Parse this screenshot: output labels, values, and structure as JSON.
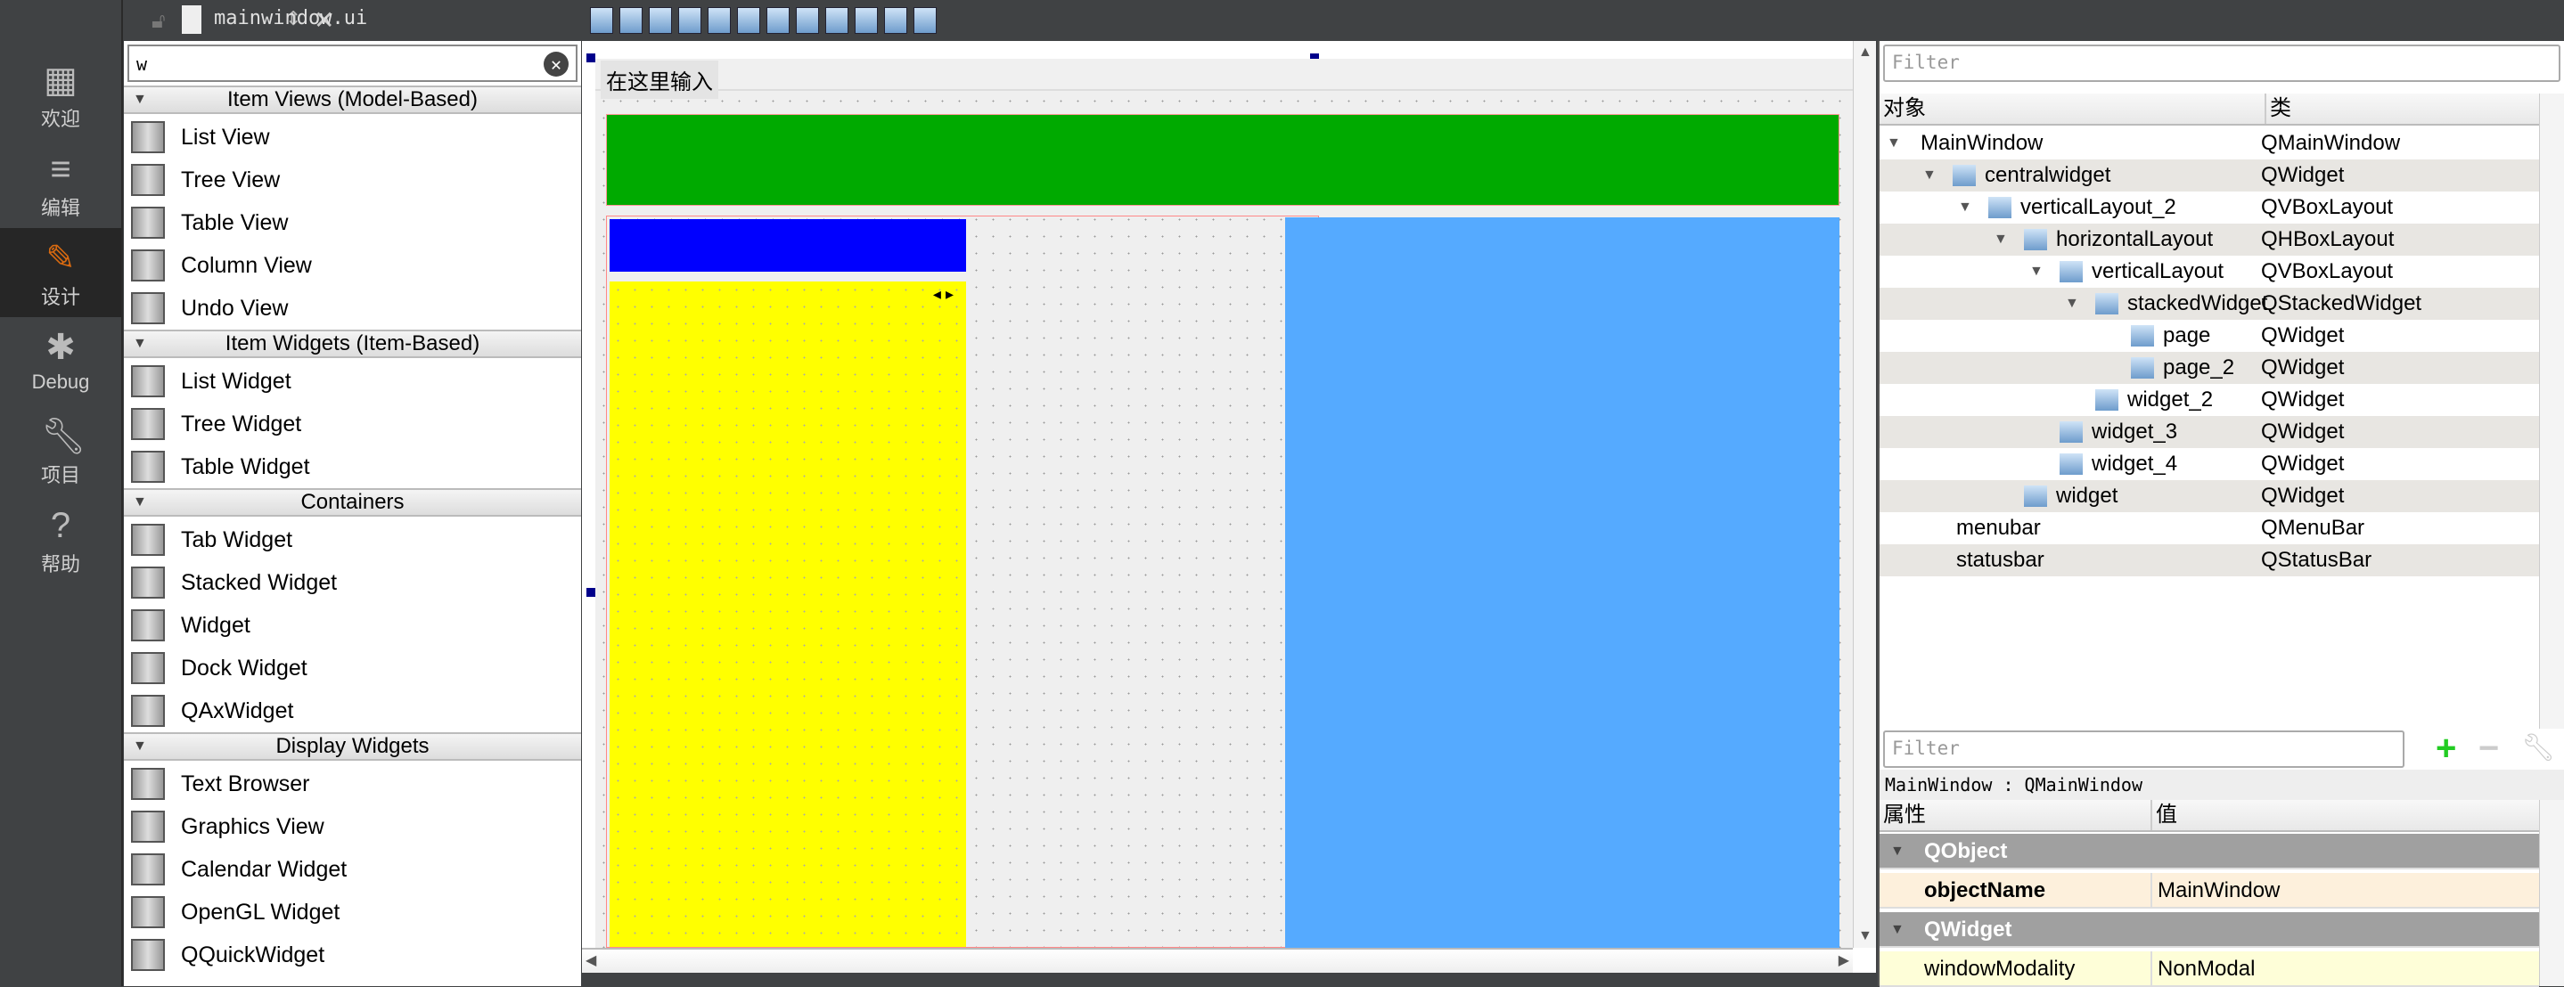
{
  "modebar": [
    {
      "label": "欢迎",
      "icon": "grid-icon"
    },
    {
      "label": "编辑",
      "icon": "document-icon"
    },
    {
      "label": "设计",
      "icon": "pencil-icon",
      "active": true
    },
    {
      "label": "Debug",
      "icon": "bug-icon"
    },
    {
      "label": "项目",
      "icon": "wrench-icon"
    },
    {
      "label": "帮助",
      "icon": "help-icon"
    }
  ],
  "topbar": {
    "file": "mainwindow.ui"
  },
  "widgetbox": {
    "search": "w",
    "categories": [
      {
        "title": "Item Views (Model-Based)",
        "items": [
          "List View",
          "Tree View",
          "Table View",
          "Column View",
          "Undo View"
        ]
      },
      {
        "title": "Item Widgets (Item-Based)",
        "items": [
          "List Widget",
          "Tree Widget",
          "Table Widget"
        ]
      },
      {
        "title": "Containers",
        "items": [
          "Tab Widget",
          "Stacked Widget",
          "Widget",
          "Dock Widget",
          "QAxWidget"
        ]
      },
      {
        "title": "Display Widgets",
        "items": [
          "Text Browser",
          "Graphics View",
          "Calendar Widget",
          "OpenGL Widget",
          "QQuickWidget"
        ]
      }
    ]
  },
  "form": {
    "menu_placeholder": "在这里输入",
    "colors": {
      "green": "#00aa00",
      "blue": "#0000ff",
      "yellow": "#ffff00",
      "lightblue": "#55aaff"
    }
  },
  "object_inspector": {
    "filter_placeholder": "Filter",
    "col_object": "对象",
    "col_class": "类",
    "rows": [
      {
        "name": "MainWindow",
        "cls": "QMainWindow",
        "depth": 0,
        "exp": true
      },
      {
        "name": "centralwidget",
        "cls": "QWidget",
        "depth": 1,
        "exp": true
      },
      {
        "name": "verticalLayout_2",
        "cls": "QVBoxLayout",
        "depth": 2,
        "exp": true
      },
      {
        "name": "horizontalLayout",
        "cls": "QHBoxLayout",
        "depth": 3,
        "exp": true
      },
      {
        "name": "verticalLayout",
        "cls": "QVBoxLayout",
        "depth": 4,
        "exp": true
      },
      {
        "name": "stackedWidget",
        "cls": "QStackedWidget",
        "depth": 5,
        "exp": true
      },
      {
        "name": "page",
        "cls": "QWidget",
        "depth": 6
      },
      {
        "name": "page_2",
        "cls": "QWidget",
        "depth": 6
      },
      {
        "name": "widget_2",
        "cls": "QWidget",
        "depth": 5
      },
      {
        "name": "widget_3",
        "cls": "QWidget",
        "depth": 4
      },
      {
        "name": "widget_4",
        "cls": "QWidget",
        "depth": 4
      },
      {
        "name": "widget",
        "cls": "QWidget",
        "depth": 3
      },
      {
        "name": "menubar",
        "cls": "QMenuBar",
        "depth": 1
      },
      {
        "name": "statusbar",
        "cls": "QStatusBar",
        "depth": 1
      }
    ]
  },
  "property_editor": {
    "filter_placeholder": "Filter",
    "context": "MainWindow : QMainWindow",
    "col_prop": "属性",
    "col_value": "值",
    "rows": [
      {
        "group": "QObject"
      },
      {
        "name": "objectName",
        "value": "MainWindow",
        "bold": true
      },
      {
        "group": "QWidget"
      },
      {
        "name": "windowModality",
        "value": "NonModal"
      }
    ]
  }
}
